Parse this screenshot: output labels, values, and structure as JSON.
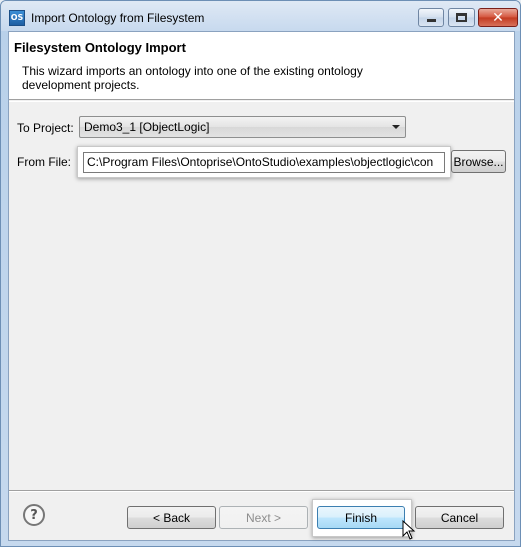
{
  "window": {
    "title": "Import Ontology from Filesystem",
    "app_icon_text": "OS"
  },
  "header": {
    "title": "Filesystem Ontology Import",
    "description": "This wizard imports an ontology into one of the existing ontology development projects."
  },
  "form": {
    "project_label": "To Project:",
    "project_value": "Demo3_1 [ObjectLogic]",
    "file_label": "From File:",
    "file_value": "C:\\Program Files\\Ontoprise\\OntoStudio\\examples\\objectlogic\\con",
    "browse_label": "Browse..."
  },
  "buttons": {
    "help": "?",
    "back": "< Back",
    "next": "Next >",
    "finish": "Finish",
    "cancel": "Cancel"
  },
  "colors": {
    "title_bar": "#c7d9ee",
    "close_button": "#c23a20",
    "finish_highlight": "#bee6fd"
  }
}
